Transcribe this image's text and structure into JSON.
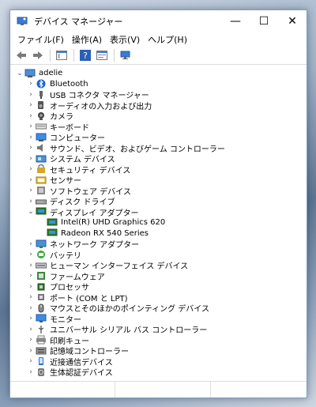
{
  "window": {
    "title": "デバイス マネージャー"
  },
  "menu": [
    "ファイル(F)",
    "操作(A)",
    "表示(V)",
    "ヘルプ(H)"
  ],
  "tree": {
    "root": "adelie",
    "items": [
      {
        "label": "Bluetooth",
        "icon": "bluetooth-icon"
      },
      {
        "label": "USB コネクタ マネージャー",
        "icon": "usb-connector-icon"
      },
      {
        "label": "オーディオの入力および出力",
        "icon": "speaker-icon"
      },
      {
        "label": "カメラ",
        "icon": "camera-icon"
      },
      {
        "label": "キーボード",
        "icon": "keyboard-icon"
      },
      {
        "label": "コンピューター",
        "icon": "computer-icon"
      },
      {
        "label": "サウンド、ビデオ、およびゲーム コントローラー",
        "icon": "sound-icon"
      },
      {
        "label": "システム デバイス",
        "icon": "system-device-icon"
      },
      {
        "label": "セキュリティ デバイス",
        "icon": "security-device-icon"
      },
      {
        "label": "センサー",
        "icon": "sensor-icon"
      },
      {
        "label": "ソフトウェア デバイス",
        "icon": "software-device-icon"
      },
      {
        "label": "ディスク ドライブ",
        "icon": "disk-drive-icon"
      },
      {
        "label": "ディスプレイ アダプター",
        "icon": "display-adapter-icon",
        "expanded": true,
        "children": [
          "Intel(R) UHD Graphics 620",
          "Radeon RX 540 Series"
        ]
      },
      {
        "label": "ネットワーク アダプター",
        "icon": "network-adapter-icon"
      },
      {
        "label": "バッテリ",
        "icon": "battery-icon"
      },
      {
        "label": "ヒューマン インターフェイス デバイス",
        "icon": "hid-icon"
      },
      {
        "label": "ファームウェア",
        "icon": "firmware-icon"
      },
      {
        "label": "プロセッサ",
        "icon": "processor-icon"
      },
      {
        "label": "ポート (COM と LPT)",
        "icon": "port-icon"
      },
      {
        "label": "マウスとそのほかのポインティング デバイス",
        "icon": "mouse-icon"
      },
      {
        "label": "モニター",
        "icon": "monitor-icon"
      },
      {
        "label": "ユニバーサル シリアル バス コントローラー",
        "icon": "usb-controller-icon"
      },
      {
        "label": "印刷キュー",
        "icon": "printer-icon"
      },
      {
        "label": "記憶域コントローラー",
        "icon": "storage-controller-icon"
      },
      {
        "label": "近接通信デバイス",
        "icon": "proximity-icon"
      },
      {
        "label": "生体認証デバイス",
        "icon": "biometric-icon"
      }
    ]
  }
}
